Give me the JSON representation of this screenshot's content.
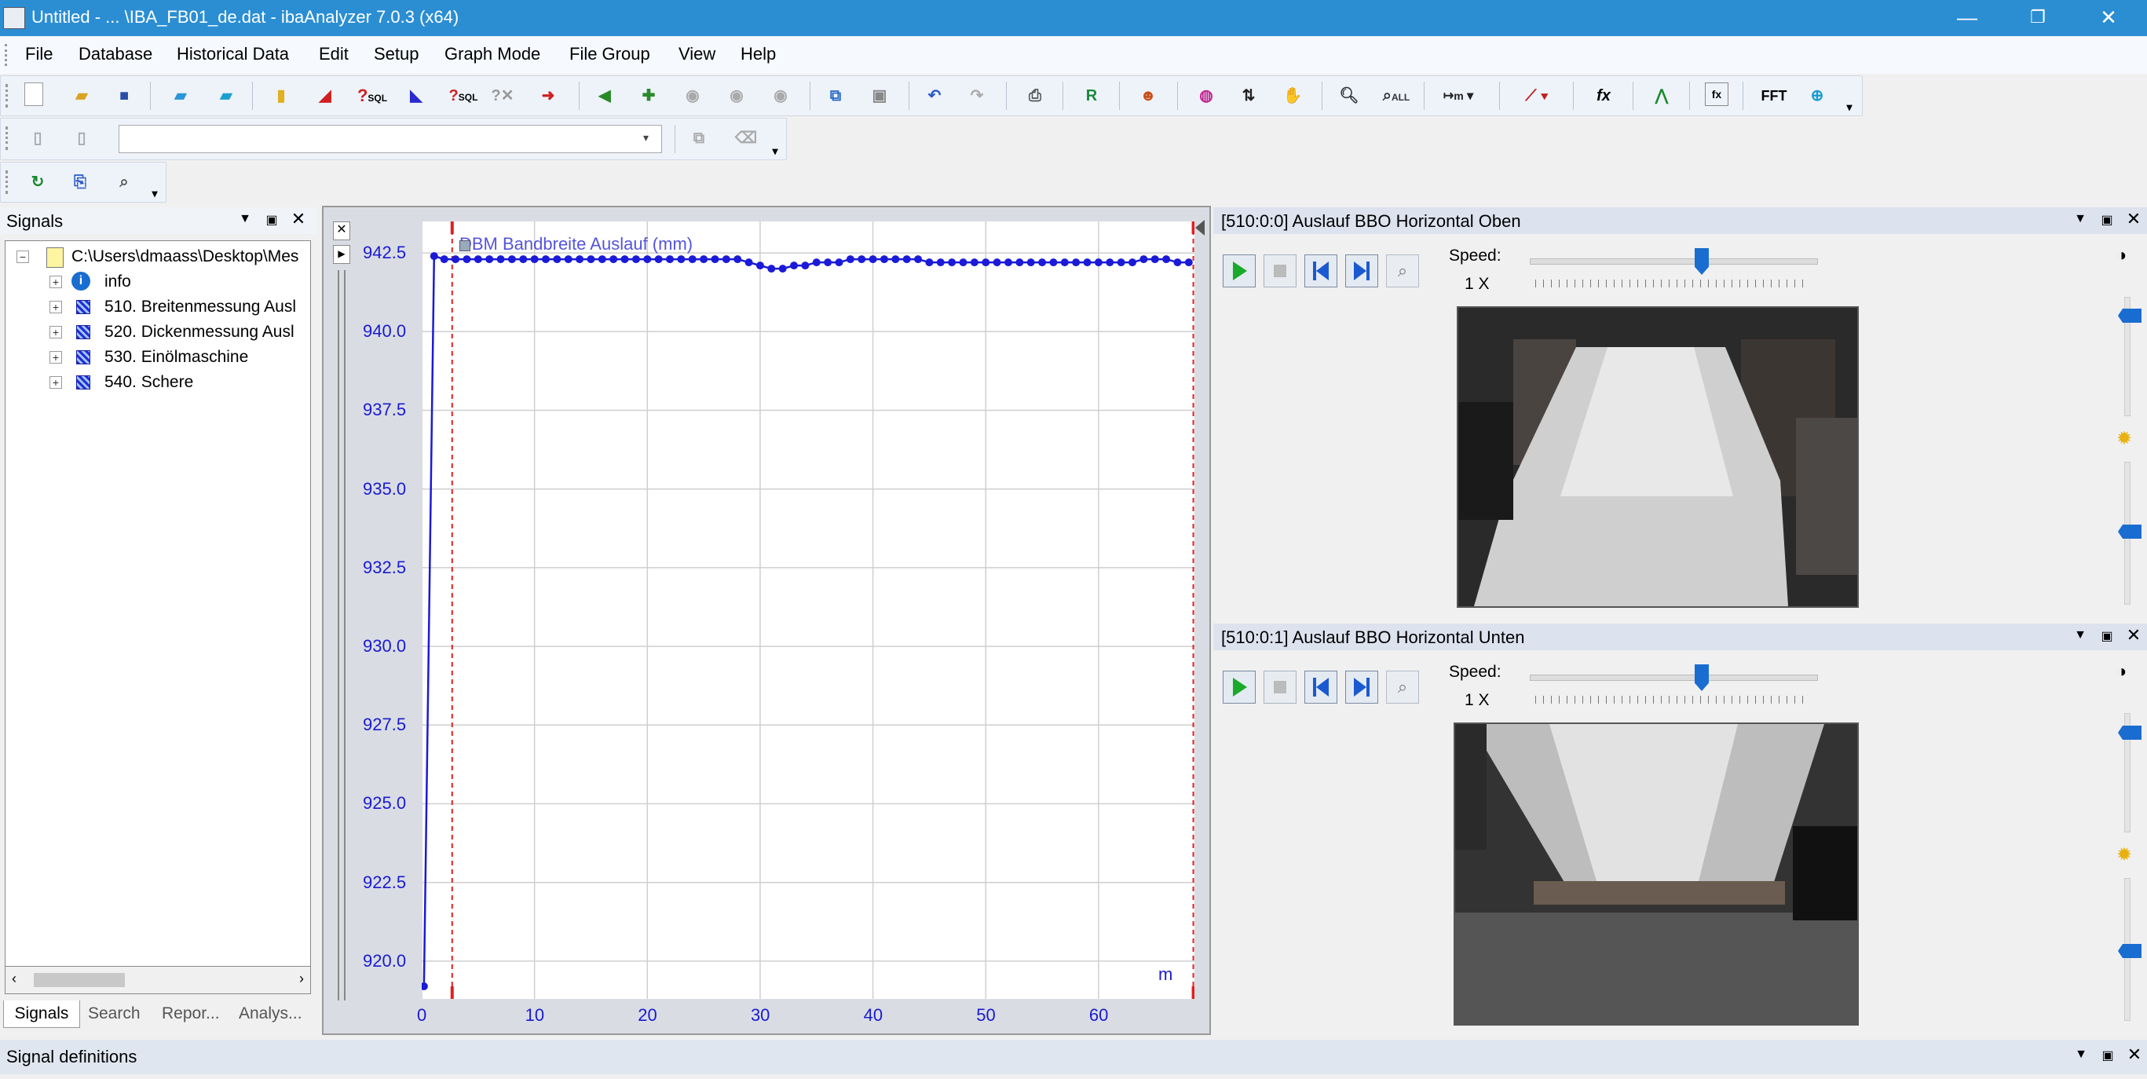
{
  "window": {
    "title": "Untitled - ... \\IBA_FB01_de.dat - ibaAnalyzer 7.0.3 (x64)",
    "minimize": "—",
    "maximize": "❐",
    "close": "✕"
  },
  "menu": [
    "File",
    "Database",
    "Historical Data",
    "Edit",
    "Setup",
    "Graph Mode",
    "File Group",
    "View",
    "Help"
  ],
  "toolbar": {
    "main_icons": [
      "new-icon",
      "open-icon",
      "save-icon",
      "open-folder-icon",
      "open-folder-2-icon",
      "database-icon",
      "chart-icon",
      "sql-icon",
      "chart-edit-icon",
      "sql-chart-icon",
      "query-icon",
      "db-arrow-icon",
      "nav-back-icon",
      "nav-add-icon",
      "nav-1-icon",
      "nav-2-icon",
      "nav-3-icon",
      "copy-icon",
      "paste-icon",
      "undo-icon",
      "redo-icon",
      "print-icon",
      "report-icon",
      "user-icon",
      "color-icon",
      "axis-icon",
      "hand-icon",
      "zoom-icon",
      "zoom-all-icon",
      "measure-icon",
      "graph-icon",
      "function-icon",
      "peak-icon",
      "formula-icon",
      "fft-icon",
      "link-icon"
    ],
    "fft_label": "FFT",
    "fx_label": "fx",
    "zoom_all_label": "ALL",
    "sql_label": "SQL",
    "measure_unit": "m",
    "expression_value": ""
  },
  "signals_panel": {
    "title": "Signals",
    "root": "C:\\Users\\dmaass\\Desktop\\Mes",
    "items": [
      {
        "label": "info",
        "icon": "info-icon"
      },
      {
        "label": "510. Breitenmessung Ausl",
        "icon": "signal-group-icon"
      },
      {
        "label": "520. Dickenmessung Ausl",
        "icon": "signal-group-icon"
      },
      {
        "label": "530. Einölmaschine",
        "icon": "signal-group-icon"
      },
      {
        "label": "540. Schere",
        "icon": "signal-group-icon"
      }
    ],
    "tabs": [
      "Signals",
      "Search",
      "Repor...",
      "Analys..."
    ]
  },
  "graph": {
    "legend": "DBM Bandbreite Auslauf (mm)",
    "x_unit": "m"
  },
  "chart_data": {
    "type": "line",
    "title": "",
    "xlabel": "m",
    "ylabel": "",
    "xlim": [
      0,
      68.5
    ],
    "ylim": [
      918.8,
      943.5
    ],
    "x_ticks": [
      "0",
      "10",
      "20",
      "30",
      "40",
      "50",
      "60"
    ],
    "y_ticks": [
      "942.5",
      "940.0",
      "937.5",
      "935.0",
      "932.5",
      "930.0",
      "927.5",
      "925.0",
      "922.5",
      "920.0"
    ],
    "markers_x": [
      2.7,
      68.4
    ],
    "series": [
      {
        "name": "DBM Bandbreite Auslauf (mm)",
        "color": "#1a1ad8",
        "x": [
          0.2,
          1.1,
          2.0,
          3.0,
          4.0,
          5.0,
          6.0,
          7.0,
          8.0,
          9.0,
          10.0,
          11.0,
          12.0,
          13.0,
          14.0,
          15.0,
          16.0,
          17.0,
          18.0,
          19.0,
          20.0,
          21.0,
          22.0,
          23.0,
          24.0,
          25.0,
          26.0,
          27.0,
          28.0,
          29.0,
          30.0,
          31.0,
          32.0,
          33.0,
          34.0,
          35.0,
          36.0,
          37.0,
          38.0,
          39.0,
          40.0,
          41.0,
          42.0,
          43.0,
          44.0,
          45.0,
          46.0,
          47.0,
          48.0,
          49.0,
          50.0,
          51.0,
          52.0,
          53.0,
          54.0,
          55.0,
          56.0,
          57.0,
          58.0,
          59.0,
          60.0,
          61.0,
          62.0,
          63.0,
          64.0,
          65.0,
          66.0,
          67.0,
          68.0
        ],
        "values": [
          919.2,
          942.4,
          942.3,
          942.3,
          942.3,
          942.3,
          942.3,
          942.3,
          942.3,
          942.3,
          942.3,
          942.3,
          942.3,
          942.3,
          942.3,
          942.3,
          942.3,
          942.3,
          942.3,
          942.3,
          942.3,
          942.3,
          942.3,
          942.3,
          942.3,
          942.3,
          942.3,
          942.3,
          942.3,
          942.2,
          942.1,
          942.0,
          942.0,
          942.1,
          942.1,
          942.2,
          942.2,
          942.2,
          942.3,
          942.3,
          942.3,
          942.3,
          942.3,
          942.3,
          942.3,
          942.2,
          942.2,
          942.2,
          942.2,
          942.2,
          942.2,
          942.2,
          942.2,
          942.2,
          942.2,
          942.2,
          942.2,
          942.2,
          942.2,
          942.2,
          942.2,
          942.2,
          942.2,
          942.2,
          942.3,
          942.3,
          942.3,
          942.2,
          942.2
        ]
      }
    ]
  },
  "video1": {
    "title": "[510:0:0] Auslauf BBO Horizontal Oben",
    "speed_label": "Speed:",
    "speed_value": "1 X",
    "speed_fraction": 0.6
  },
  "video2": {
    "title": "[510:0:1] Auslauf BBO Horizontal Unten",
    "speed_label": "Speed:",
    "speed_value": "1 X",
    "speed_fraction": 0.6
  },
  "signal_definitions": {
    "title": "Signal definitions"
  },
  "colors": {
    "titlebar": "#2b8ed3",
    "signal": "#1a1ad8",
    "marker": "#e02020",
    "accent": "#1a6dd0"
  }
}
